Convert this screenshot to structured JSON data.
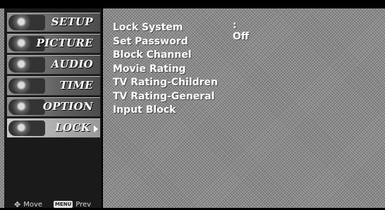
{
  "sidebar": {
    "items": [
      {
        "label": "SETUP",
        "icon": "setup-icon"
      },
      {
        "label": "PICTURE",
        "icon": "picture-icon"
      },
      {
        "label": "AUDIO",
        "icon": "audio-icon"
      },
      {
        "label": "TIME",
        "icon": "time-icon"
      },
      {
        "label": "OPTION",
        "icon": "option-icon"
      },
      {
        "label": "LOCK",
        "icon": "lock-icon",
        "selected": true
      }
    ]
  },
  "footer": {
    "move_label": "Move",
    "menu_key": "MENU",
    "prev_label": "Prev"
  },
  "lock_menu": {
    "items": [
      {
        "label": "Lock System",
        "value": ": Off"
      },
      {
        "label": "Set Password"
      },
      {
        "label": "Block Channel"
      },
      {
        "label": "Movie Rating"
      },
      {
        "label": "TV Rating-Children"
      },
      {
        "label": "TV Rating-General"
      },
      {
        "label": "Input Block"
      }
    ]
  }
}
